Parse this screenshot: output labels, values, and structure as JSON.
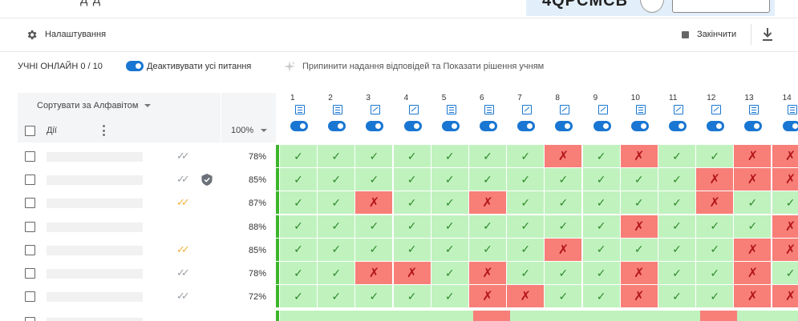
{
  "header": {
    "settings_label": "Налаштування",
    "finish_label": "Закінчити"
  },
  "info": {
    "students_online": "УЧНІ ОНЛАЙН 0 / 10",
    "deactivate_all_label": "Деактивувати усі питання",
    "stop_answers_label": "Припинити надання відповідей та Показати рішення учням"
  },
  "table": {
    "sort_label": "Сортувати за Алфавітом",
    "actions_label": "Дії",
    "percent_filter": "100%",
    "questions": [
      {
        "num": "1",
        "icon": "list-question-icon"
      },
      {
        "num": "2",
        "icon": "list-question-icon"
      },
      {
        "num": "3",
        "icon": "image-question-icon"
      },
      {
        "num": "4",
        "icon": "image-question-icon"
      },
      {
        "num": "5",
        "icon": "list-question-icon"
      },
      {
        "num": "6",
        "icon": "list-question-icon"
      },
      {
        "num": "7",
        "icon": "image-question-icon"
      },
      {
        "num": "8",
        "icon": "image-question-icon"
      },
      {
        "num": "9",
        "icon": "image-question-icon"
      },
      {
        "num": "10",
        "icon": "list-question-icon"
      },
      {
        "num": "11",
        "icon": "image-question-icon"
      },
      {
        "num": "12",
        "icon": "image-question-icon"
      },
      {
        "num": "13",
        "icon": "list-question-icon"
      },
      {
        "num": "14",
        "icon": "list-question-icon"
      }
    ],
    "rows": [
      {
        "percent": "78%",
        "status": "grey",
        "shield": false,
        "answers": "✓✓✓✓✓✓✓✗✓✗✓✓✗✗"
      },
      {
        "percent": "85%",
        "status": "grey",
        "shield": true,
        "answers": "✓✓✓✓✓✓✓✓✓✓✓✗✗✗"
      },
      {
        "percent": "87%",
        "status": "orange",
        "shield": false,
        "answers": "✓✓✗✓✓✗✓✓✓✓✓✗✓✓"
      },
      {
        "percent": "88%",
        "status": "none",
        "shield": false,
        "answers": "✓✓✓✓✓✓✓✓✓✗✓✓✓✗"
      },
      {
        "percent": "85%",
        "status": "orange",
        "shield": false,
        "answers": "✓✓✓✓✓✓✓✗✓✓✓✓✗✗"
      },
      {
        "percent": "78%",
        "status": "grey",
        "shield": false,
        "answers": "✓✓✗✗✓✗✓✓✓✗✓✓✗✓"
      },
      {
        "percent": "72%",
        "status": "grey",
        "shield": false,
        "answers": "✓✓✓✓✓✗✗✓✓✗✓✓✗✗"
      }
    ]
  },
  "colors": {
    "accent": "#1976d2",
    "correct_bg": "#c0f2be",
    "correct_mark": "#2e8a2a",
    "wrong_bg": "#f77f78",
    "wrong_mark": "#b3161a",
    "progress_bar": "#3cb52b",
    "tick_grey": "#9aa0a6",
    "tick_orange": "#f0b43c"
  }
}
